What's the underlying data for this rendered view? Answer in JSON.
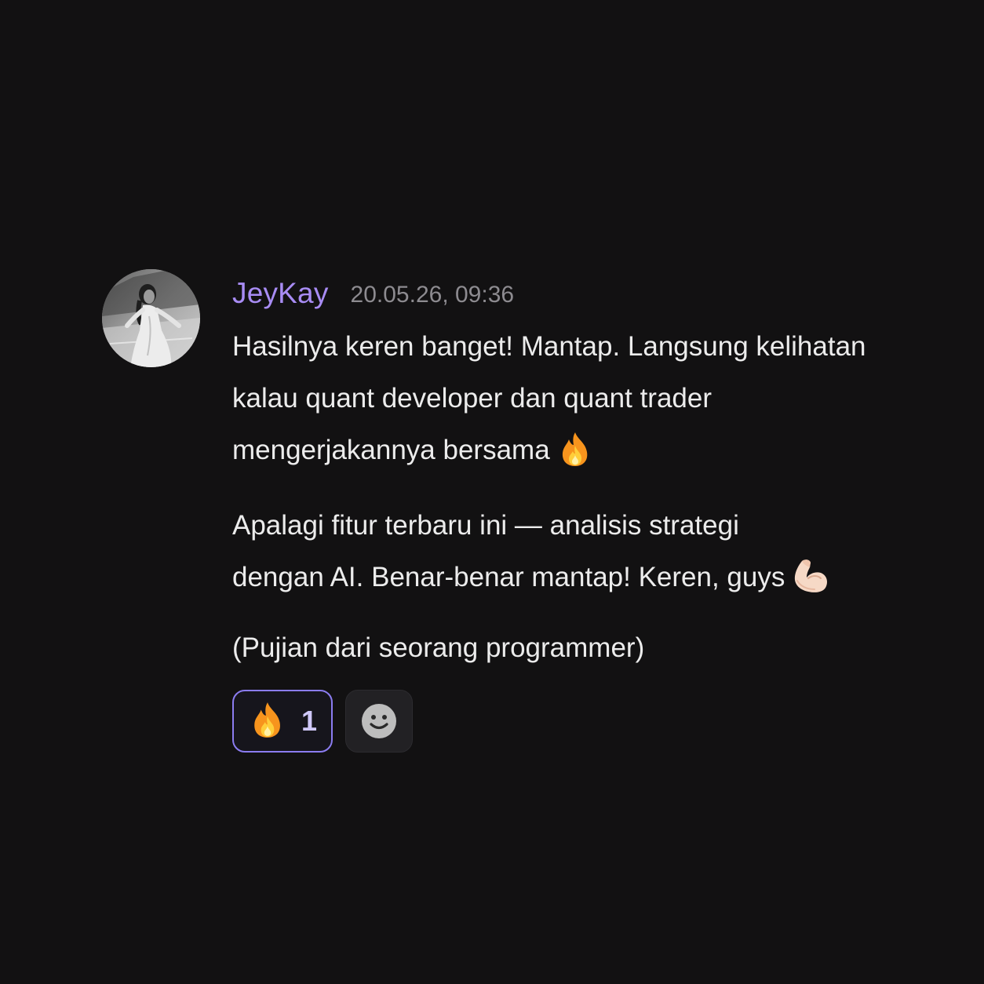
{
  "message": {
    "username": "JeyKay",
    "timestamp": "20.05.26, 09:36",
    "avatar_icon": "user-avatar-photo",
    "paragraphs": [
      {
        "lines": [
          "Hasilnya keren banget! Mantap. Langsung kelihatan",
          "kalau quant developer dan quant trader",
          "mengerjakannya bersama"
        ],
        "trailing_emoji": "fire-emoji"
      },
      {
        "lines": [
          "Apalagi fitur terbaru ini — analisis strategi",
          "dengan AI. Benar-benar mantap! Keren, guys"
        ],
        "trailing_emoji": "flexed-biceps-emoji"
      },
      {
        "lines": [
          "(Pujian dari seorang programmer)"
        ]
      }
    ]
  },
  "reactions": [
    {
      "emoji": "fire-emoji",
      "count": "1",
      "active": true
    }
  ],
  "add_reaction": {
    "icon": "smiley-icon"
  },
  "colors": {
    "background": "#121112",
    "username": "#a88cf4",
    "timestamp": "#8d8b90",
    "text": "#ececec",
    "reaction_border": "#8b7cf0",
    "add_reaction_bg": "#222124"
  }
}
